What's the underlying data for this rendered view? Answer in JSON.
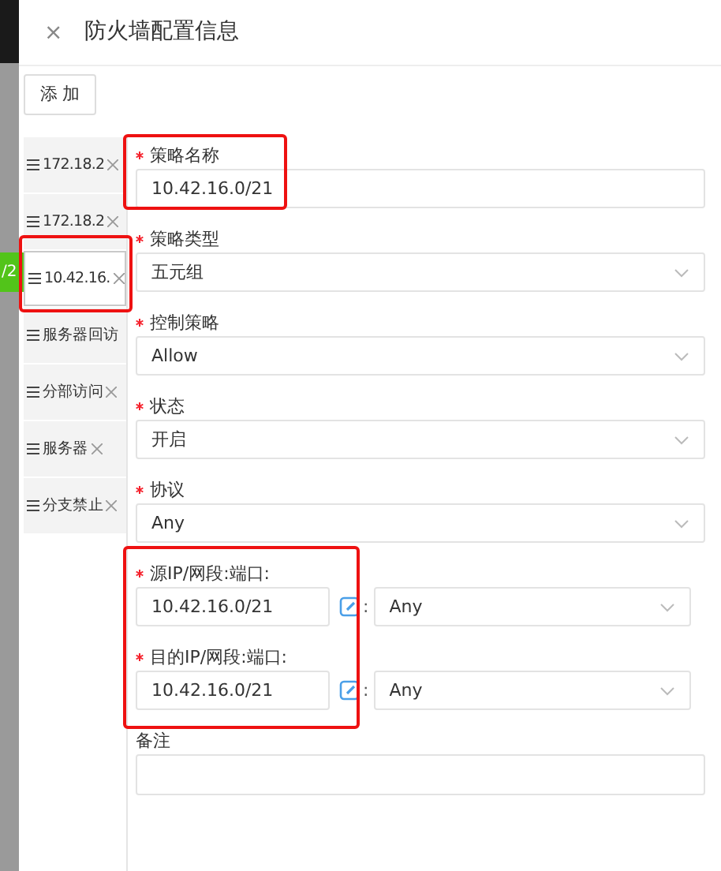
{
  "dialog": {
    "title": "防火墙配置信息",
    "close": "×"
  },
  "add_button": "添 加",
  "background_tag": "/2",
  "rules": [
    {
      "label": "172.18.2",
      "closable": true,
      "selected": false
    },
    {
      "label": "172.18.2",
      "closable": true,
      "selected": false
    },
    {
      "label": "10.42.16.",
      "closable": true,
      "selected": true
    },
    {
      "label": "服务器回访",
      "closable": false,
      "selected": false
    },
    {
      "label": "分部访问",
      "closable": true,
      "selected": false
    },
    {
      "label": "服务器",
      "closable": true,
      "selected": false
    },
    {
      "label": "分支禁止",
      "closable": true,
      "selected": false
    }
  ],
  "form": [
    {
      "kind": "text",
      "label": "策略名称",
      "required": true,
      "value": "10.42.16.0/21"
    },
    {
      "kind": "select",
      "label": "策略类型",
      "required": true,
      "value": "五元组"
    },
    {
      "kind": "select",
      "label": "控制策略",
      "required": true,
      "value": "Allow"
    },
    {
      "kind": "select",
      "label": "状态",
      "required": true,
      "value": "开启"
    },
    {
      "kind": "select",
      "label": "协议",
      "required": true,
      "value": "Any"
    },
    {
      "kind": "ip_port",
      "label": "源IP/网段:端口:",
      "required": true,
      "value": "10.42.16.0/21",
      "separator": ":",
      "port": "Any"
    },
    {
      "kind": "ip_port",
      "label": "目的IP/网段:端口:",
      "required": true,
      "value": "10.42.16.0/21",
      "separator": ":",
      "port": "Any"
    },
    {
      "kind": "textarea",
      "label": "备注",
      "required": false
    }
  ]
}
